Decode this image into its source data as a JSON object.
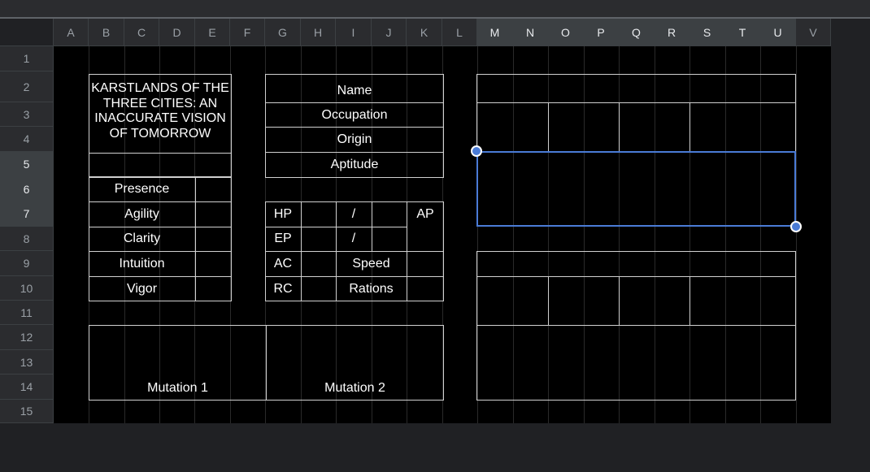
{
  "columns": [
    "A",
    "B",
    "C",
    "D",
    "E",
    "F",
    "G",
    "H",
    "I",
    "J",
    "K",
    "L",
    "M",
    "N",
    "O",
    "P",
    "Q",
    "R",
    "S",
    "T",
    "U",
    "V"
  ],
  "rows": [
    "1",
    "2",
    "3",
    "4",
    "5",
    "6",
    "7",
    "8",
    "9",
    "10",
    "11",
    "12",
    "13",
    "14",
    "15"
  ],
  "sheet": {
    "title": "KARSTLANDS OF THE THREE CITIES: AN INACCURATE VISION OF TOMORROW",
    "attributes": [
      "Presence",
      "Agility",
      "Clarity",
      "Intuition",
      "Vigor"
    ],
    "info_fields": [
      "Name",
      "Occupation",
      "Origin",
      "Aptitude"
    ],
    "stats": {
      "hp": "HP",
      "ep": "EP",
      "slash": "/",
      "ap": "AP",
      "ac": "AC",
      "speed": "Speed",
      "rc": "RC",
      "rations": "Rations"
    },
    "mutation_1": "Mutation 1",
    "mutation_2": "Mutation 2"
  },
  "colors": {
    "selection": "#4a7bd6",
    "cell_background": "#000000",
    "border": "#d0d0d0"
  }
}
